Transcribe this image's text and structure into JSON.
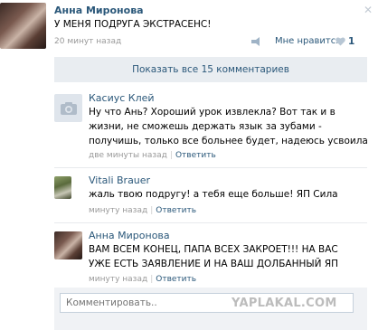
{
  "post": {
    "author": "Анна Миронова",
    "text": "У МЕНЯ ПОДРУГА ЭКСТРАСЕНС!",
    "time": "20 минут назад",
    "like_label": "Мне нравится",
    "like_count": "1",
    "close_glyph": "✕"
  },
  "show_all_label": "Показать все 15 комментариев",
  "comments": [
    {
      "author": "Касиус Клей",
      "text": "Ну что Ань? Хороший урок извлекла? Вот так и в жизни, не сможешь держать язык за зубами - получишь, только все больнее будет, надеюсь усвоила",
      "time": "две минуты назад",
      "reply": "Ответить"
    },
    {
      "author": "Vitali Brauer",
      "text": "жаль твою подругу! а тебя еще больше! ЯП Сила",
      "time": "минуту назад",
      "reply": "Ответить"
    },
    {
      "author": "Анна Миронова",
      "text": "ВАМ ВСЕМ КОНЕЦ, ПАПА ВСЕХ ЗАКРОЕТ!!! НА ВАС УЖЕ ЕСТЬ ЗАЯВЛЕНИЕ И НА ВАШ ДОЛБАННЫЙ ЯП",
      "time": "минуту назад",
      "reply": "Ответить"
    }
  ],
  "comment_input": {
    "placeholder": "Комментировать.."
  },
  "watermark": "YAPLAKAL.COM",
  "colors": {
    "link": "#2b587a",
    "meta": "#999999",
    "panel": "#e9edf1"
  },
  "icons": [
    "camera-icon",
    "share-icon",
    "heart-icon",
    "close-icon"
  ]
}
